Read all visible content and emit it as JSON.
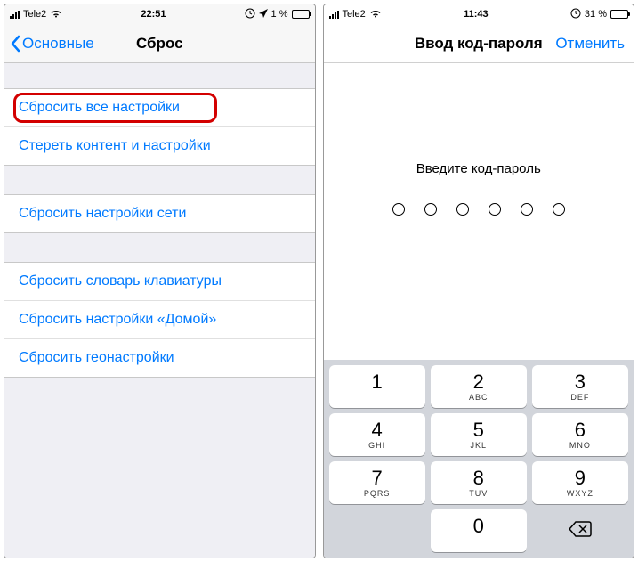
{
  "left": {
    "status": {
      "carrier": "Tele2",
      "time": "22:51",
      "battery_pct": "1 %",
      "battery_fill": 3
    },
    "nav": {
      "back": "Основные",
      "title": "Сброс"
    },
    "group1": [
      "Сбросить все настройки",
      "Стереть контент и настройки"
    ],
    "group2": [
      "Сбросить настройки сети"
    ],
    "group3": [
      "Сбросить словарь клавиатуры",
      "Сбросить настройки «Домой»",
      "Сбросить геонастройки"
    ]
  },
  "right": {
    "status": {
      "carrier": "Tele2",
      "time": "11:43",
      "battery_pct": "31 %",
      "battery_fill": 31
    },
    "nav": {
      "title": "Ввод код-пароля",
      "cancel": "Отменить"
    },
    "prompt": "Введите код-пароль",
    "keys": [
      {
        "d": "1",
        "l": ""
      },
      {
        "d": "2",
        "l": "ABC"
      },
      {
        "d": "3",
        "l": "DEF"
      },
      {
        "d": "4",
        "l": "GHI"
      },
      {
        "d": "5",
        "l": "JKL"
      },
      {
        "d": "6",
        "l": "MNO"
      },
      {
        "d": "7",
        "l": "PQRS"
      },
      {
        "d": "8",
        "l": "TUV"
      },
      {
        "d": "9",
        "l": "WXYZ"
      },
      {
        "d": "0",
        "l": ""
      }
    ]
  }
}
